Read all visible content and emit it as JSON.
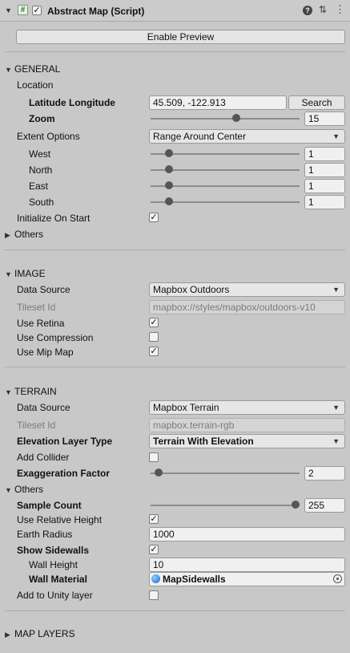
{
  "header": {
    "title": "Abstract Map (Script)",
    "script_icon": "hash-script-icon",
    "enabled": true,
    "help_icon": "help-icon",
    "preset_icon": "sliders-icon",
    "menu_icon": "kebab-menu-icon"
  },
  "toolbar": {
    "enable_preview_label": "Enable Preview"
  },
  "general": {
    "title": "GENERAL",
    "location_label": "Location",
    "latlon_label": "Latitude Longitude",
    "latlon_value": "45.509, -122.913",
    "search_label": "Search",
    "zoom_label": "Zoom",
    "zoom_value": "15",
    "zoom_fraction": 0.58,
    "extent_label": "Extent Options",
    "extent_value": "Range Around Center",
    "extent_items": [
      {
        "label": "West",
        "value": "1"
      },
      {
        "label": "North",
        "value": "1"
      },
      {
        "label": "East",
        "value": "1"
      },
      {
        "label": "South",
        "value": "1"
      }
    ],
    "extent_fraction": 0.1,
    "init_label": "Initialize On Start",
    "init_checked": true,
    "others_label": "Others"
  },
  "image": {
    "title": "IMAGE",
    "source_label": "Data Source",
    "source_value": "Mapbox Outdoors",
    "tileset_label": "Tileset Id",
    "tileset_value": "mapbox://styles/mapbox/outdoors-v10",
    "retina_label": "Use Retina",
    "retina_checked": true,
    "compression_label": "Use Compression",
    "compression_checked": false,
    "mip_label": "Use Mip Map",
    "mip_checked": true
  },
  "terrain": {
    "title": "TERRAIN",
    "source_label": "Data Source",
    "source_value": "Mapbox Terrain",
    "tileset_label": "Tileset Id",
    "tileset_value": "mapbox.terrain-rgb",
    "elevation_label": "Elevation Layer Type",
    "elevation_value": "Terrain With Elevation",
    "collider_label": "Add Collider",
    "collider_checked": false,
    "exaggeration_label": "Exaggeration Factor",
    "exaggeration_value": "2",
    "exaggeration_fraction": 0.03,
    "others_label": "Others",
    "sample_label": "Sample Count",
    "sample_value": "255",
    "sample_fraction": 1.0,
    "relative_label": "Use Relative Height",
    "relative_checked": true,
    "radius_label": "Earth Radius",
    "radius_value": "1000",
    "sidewalls_label": "Show Sidewalls",
    "sidewalls_checked": true,
    "wall_height_label": "Wall Height",
    "wall_height_value": "10",
    "wall_material_label": "Wall Material",
    "wall_material_value": "MapSidewalls",
    "unity_layer_label": "Add to Unity layer",
    "unity_layer_checked": false
  },
  "map_layers": {
    "title": "MAP LAYERS"
  }
}
